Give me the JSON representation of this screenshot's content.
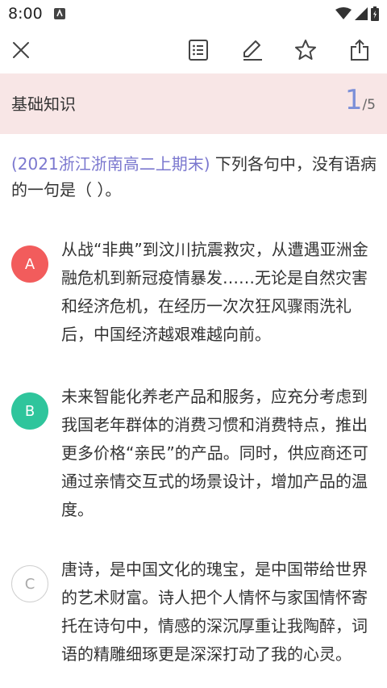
{
  "status_bar": {
    "time": "8:00"
  },
  "toolbar": {
    "icons": [
      "close-icon",
      "answer-sheet-icon",
      "edit-icon",
      "star-icon",
      "share-icon"
    ]
  },
  "section": {
    "title": "基础知识",
    "current": "1",
    "total": "/5"
  },
  "question": {
    "source": "(2021浙江浙南高二上期末)",
    "text": " 下列各句中，没有语病的一句是（ ）。"
  },
  "options": [
    {
      "letter": "A",
      "text": "从战“非典”到汶川抗震救灾，从遭遇亚洲金融危机到新冠疫情暴发……无论是自然灾害和经济危机，在经历一次次狂风骤雨洗礼后，中国经济越艰难越向前。"
    },
    {
      "letter": "B",
      "text": "未来智能化养老产品和服务，应充分考虑到我国老年群体的消费习惯和消费特点，推出更多价格“亲民”的产品。同时，供应商还可通过亲情交互式的场景设计，增加产品的温度。"
    },
    {
      "letter": "C",
      "text": "唐诗，是中国文化的瑰宝，是中国带给世界的艺术财富。诗人把个人情怀与家国情怀寄托在诗句中，情感的深沉厚重让我陶醉，词语的精雕细琢更是深深打动了我的心灵。"
    }
  ],
  "colors": {
    "header_bg": "#f8e6e6",
    "progress_accent": "#7b8fd8",
    "source_text": "#7b78cf",
    "badge_a": "#f25c5c",
    "badge_b": "#2fc59c"
  }
}
